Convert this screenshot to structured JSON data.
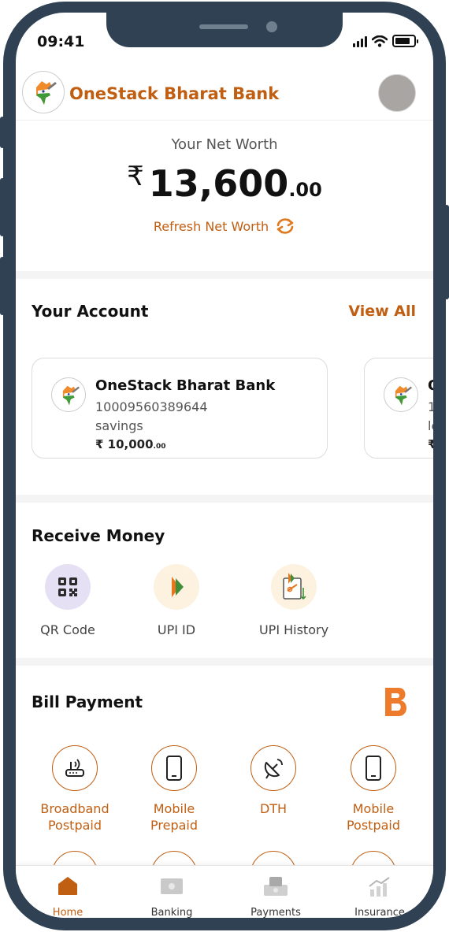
{
  "status_bar": {
    "time": "09:41"
  },
  "header": {
    "bank_name": "OneStack Bharat Bank"
  },
  "net_worth": {
    "label": "Your Net Worth",
    "currency": "₹",
    "amount_main": "13,600",
    "amount_decimal": ".00",
    "refresh_label": "Refresh Net Worth"
  },
  "accounts": {
    "title": "Your Account",
    "view_all": "View All",
    "items": [
      {
        "bank": "OneStack Bharat Bank",
        "number": "10009560389644",
        "type": "savings",
        "balance_main": "₹ 10,000",
        "balance_decimal": ".00"
      },
      {
        "bank": "O",
        "number": "1",
        "type": "le",
        "balance_main": "₹",
        "balance_decimal": ""
      }
    ]
  },
  "receive_money": {
    "title": "Receive Money",
    "items": [
      {
        "label": "QR Code",
        "icon": "qr-code-icon"
      },
      {
        "label": "UPI ID",
        "icon": "upi-icon"
      },
      {
        "label": "UPI History",
        "icon": "upi-history-icon"
      }
    ]
  },
  "bill_payment": {
    "title": "Bill Payment",
    "brand_icon": "bharat-billpay-icon",
    "items": [
      {
        "label_line1": "Broadband",
        "label_line2": "Postpaid",
        "icon": "broadband-router-icon"
      },
      {
        "label_line1": "Mobile",
        "label_line2": "Prepaid",
        "icon": "mobile-icon"
      },
      {
        "label_line1": "DTH",
        "label_line2": "",
        "icon": "satellite-dish-icon"
      },
      {
        "label_line1": "Mobile",
        "label_line2": "Postpaid",
        "icon": "mobile-icon"
      }
    ]
  },
  "bottom_nav": {
    "items": [
      {
        "label": "Home",
        "icon": "home-icon",
        "active": true
      },
      {
        "label": "Banking",
        "icon": "banking-icon",
        "active": false
      },
      {
        "label": "Payments",
        "icon": "payments-icon",
        "active": false
      },
      {
        "label": "Insurance",
        "icon": "insurance-icon",
        "active": false
      }
    ]
  },
  "colors": {
    "accent": "#c05e12",
    "frame": "#2f4152",
    "qr_bg": "#e6e0f5",
    "upi_bg": "#fdf1df"
  }
}
